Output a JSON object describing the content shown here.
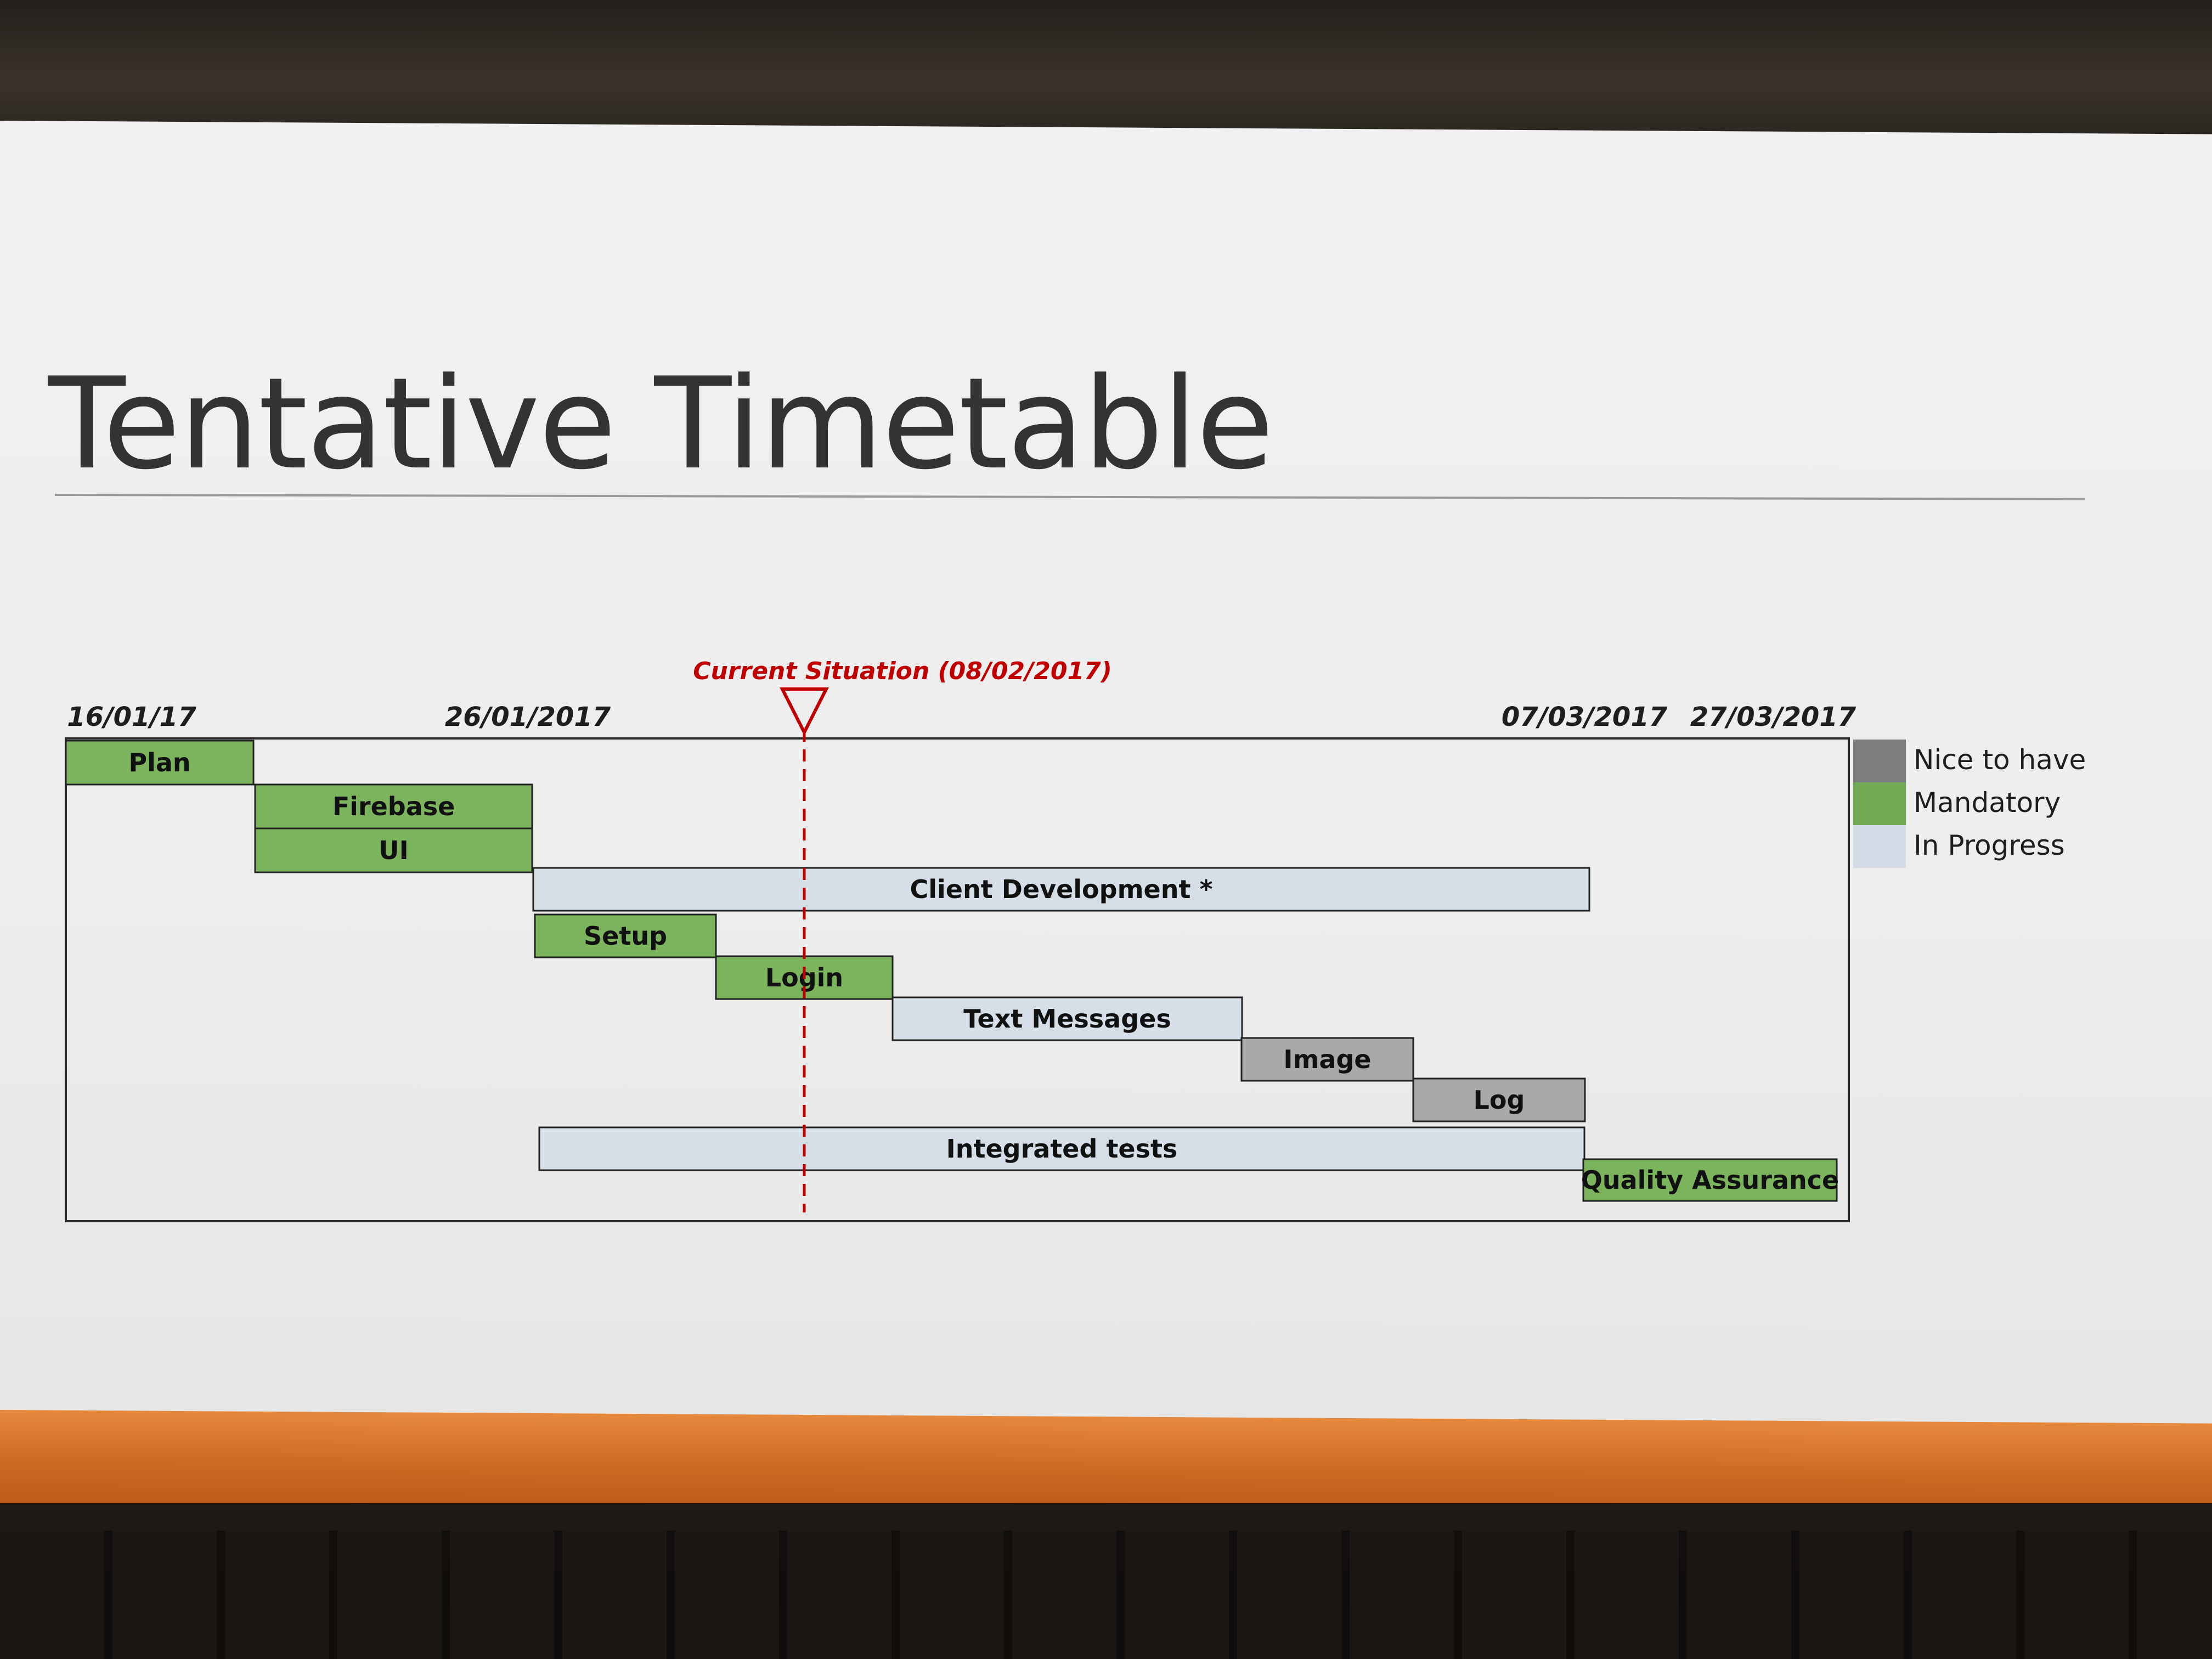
{
  "slide": {
    "title": "Tentative Timetable"
  },
  "chart_data": {
    "type": "gantt",
    "date_labels": [
      "16/01/17",
      "26/01/2017",
      "07/03/2017",
      "27/03/2017"
    ],
    "current_marker": {
      "label": "Current Situation (08/02/2017)",
      "date": "08/02/2017"
    },
    "tasks": [
      {
        "label": "Plan",
        "category": "Mandatory"
      },
      {
        "label": "Firebase",
        "category": "Mandatory"
      },
      {
        "label": "UI",
        "category": "Mandatory"
      },
      {
        "label": "Client Development *",
        "category": "In Progress"
      },
      {
        "label": "Setup",
        "category": "Mandatory"
      },
      {
        "label": "Login",
        "category": "Mandatory"
      },
      {
        "label": "Text Messages",
        "category": "In Progress"
      },
      {
        "label": "Image",
        "category": "Nice to have"
      },
      {
        "label": "Log",
        "category": "Nice to have"
      },
      {
        "label": "Integrated tests",
        "category": "In Progress"
      },
      {
        "label": "Quality Assurance",
        "category": "Mandatory"
      }
    ],
    "legend": [
      {
        "label": "Nice to have",
        "color": "#7d7d7d"
      },
      {
        "label": "Mandatory",
        "color": "#72ab55"
      },
      {
        "label": "In Progress",
        "color": "#d3dce6"
      }
    ],
    "colors": {
      "Nice to have": "#a9a9a9",
      "Mandatory": "#7cb45d",
      "In Progress": "#d6dee7",
      "marker": "#c00000"
    }
  }
}
